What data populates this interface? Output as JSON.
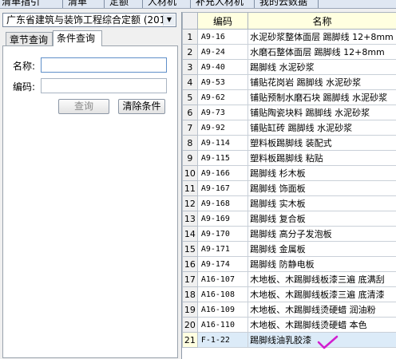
{
  "top_tabs": [
    "清单指引",
    "清单",
    "定额",
    "人材机",
    "补充人材机",
    "我的云数据"
  ],
  "left_panel": {
    "quota_library": "广东省建筑与装饰工程综合定额 (201",
    "subtabs": [
      {
        "label": "章节查询",
        "active": false
      },
      {
        "label": "条件查询",
        "active": true
      }
    ],
    "form": {
      "name_label": "名称:",
      "name_value": "",
      "code_label": "编码:",
      "code_value": "",
      "query_button": "查询",
      "clear_button": "清除条件"
    }
  },
  "grid": {
    "columns": [
      "编码",
      "名称"
    ],
    "rows": [
      {
        "no": "1",
        "code": "A9-16",
        "name": "水泥砂浆整体面层 踢脚线 12+8mm"
      },
      {
        "no": "2",
        "code": "A9-24",
        "name": "水磨石整体面层 踢脚线 12+8mm"
      },
      {
        "no": "3",
        "code": "A9-40",
        "name": "踢脚线 水泥砂浆"
      },
      {
        "no": "4",
        "code": "A9-53",
        "name": "铺贴花岗岩 踢脚线 水泥砂浆"
      },
      {
        "no": "5",
        "code": "A9-62",
        "name": "铺贴预制水磨石块 踢脚线 水泥砂浆"
      },
      {
        "no": "6",
        "code": "A9-73",
        "name": "铺贴陶瓷块料 踢脚线 水泥砂浆"
      },
      {
        "no": "7",
        "code": "A9-92",
        "name": "铺贴缸砖 踢脚线 水泥砂浆"
      },
      {
        "no": "8",
        "code": "A9-114",
        "name": "塑料板踢脚线 装配式"
      },
      {
        "no": "9",
        "code": "A9-115",
        "name": "塑料板踢脚线 粘贴"
      },
      {
        "no": "10",
        "code": "A9-166",
        "name": "踢脚线 杉木板"
      },
      {
        "no": "11",
        "code": "A9-167",
        "name": "踢脚线 饰面板"
      },
      {
        "no": "12",
        "code": "A9-168",
        "name": "踢脚线 实木板"
      },
      {
        "no": "13",
        "code": "A9-169",
        "name": "踢脚线 复合板"
      },
      {
        "no": "14",
        "code": "A9-170",
        "name": "踢脚线 高分子发泡板"
      },
      {
        "no": "15",
        "code": "A9-171",
        "name": "踢脚线 金属板"
      },
      {
        "no": "16",
        "code": "A9-174",
        "name": "踢脚线 防静电板"
      },
      {
        "no": "17",
        "code": "A16-107",
        "name": "木地板、木踢脚线板漆三遍 底满刮"
      },
      {
        "no": "18",
        "code": "A16-108",
        "name": "木地板、木踢脚线板漆三遍 底清漆"
      },
      {
        "no": "19",
        "code": "A16-109",
        "name": "木地板、木踢脚线烫硬蜡 润油粉"
      },
      {
        "no": "20",
        "code": "A16-110",
        "name": "木地板、木踢脚线烫硬蜡 本色"
      },
      {
        "no": "21",
        "code": "F-1-22",
        "name": "踢脚线油乳胶漆"
      }
    ],
    "selected_row": 21
  },
  "colors": {
    "header_bg": "#ffffe0",
    "selected_row_bg": "#dcebf8",
    "check_mark": "#d21ecf"
  }
}
